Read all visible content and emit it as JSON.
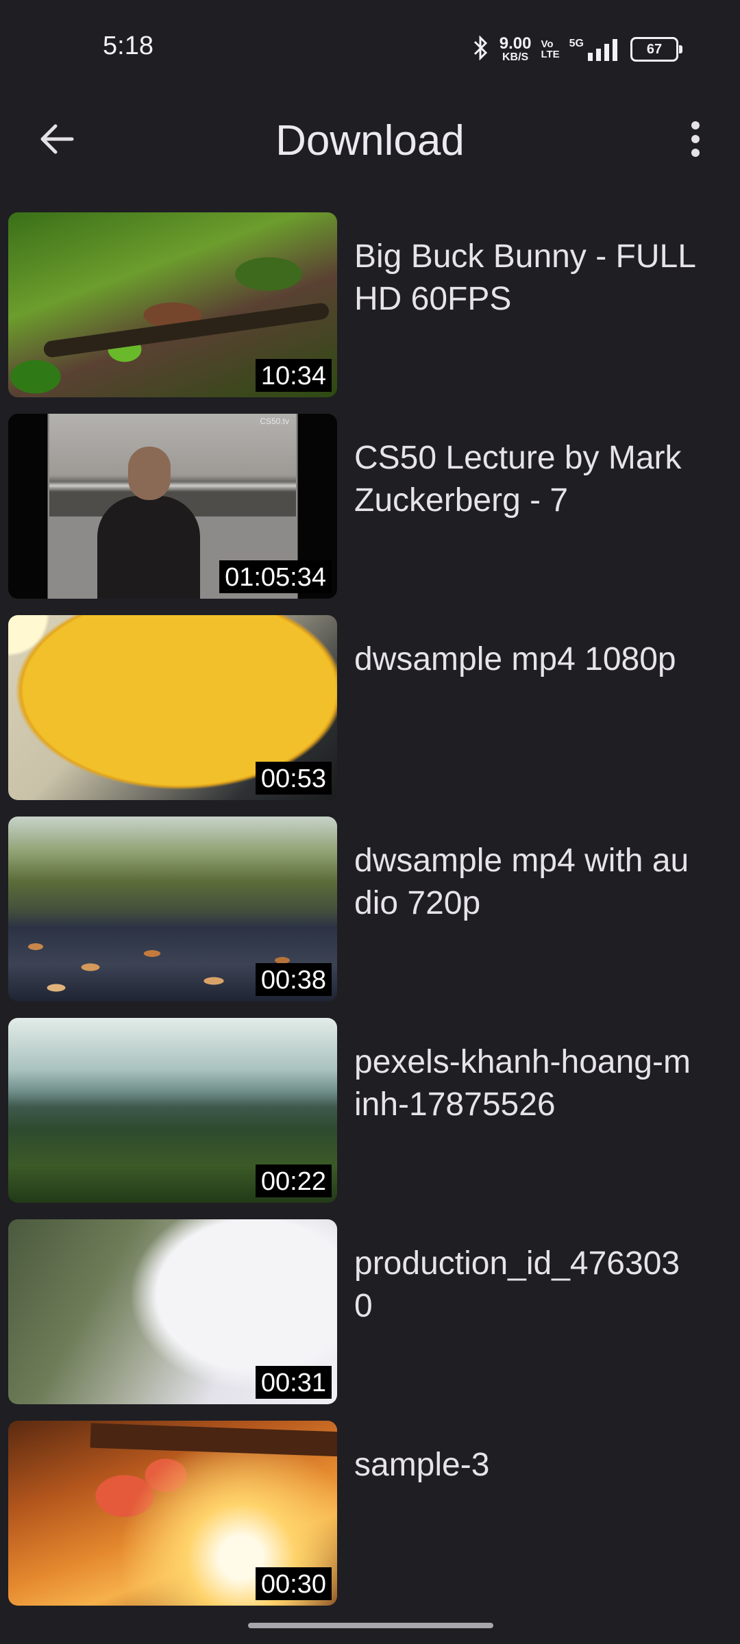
{
  "status_bar": {
    "time": "5:18",
    "net_speed_value": "9.00",
    "net_speed_unit": "KB/S",
    "volte_top": "Vo",
    "volte_bottom": "LTE",
    "network": "5G",
    "battery": "67"
  },
  "app_bar": {
    "title": "Download"
  },
  "videos": [
    {
      "title": "Big Buck Bunny - FULL HD 60FPS",
      "duration": "10:34"
    },
    {
      "title": "CS50 Lecture by Mark Zuckerberg - 7",
      "duration": "01:05:34",
      "watermark": "CS50.tv"
    },
    {
      "title": "dwsample mp4 1080p",
      "duration": "00:53"
    },
    {
      "title": "dwsample mp4 with audio 720p",
      "duration": "00:38"
    },
    {
      "title": "pexels-khanh-hoang-minh-17875526",
      "duration": "00:22"
    },
    {
      "title": "production_id_4763030",
      "duration": "00:31"
    },
    {
      "title": "sample-3",
      "duration": "00:30"
    }
  ],
  "colors": {
    "background": "#1f1e23",
    "text": "#e6e3ea",
    "duration_bg": "#000000"
  }
}
